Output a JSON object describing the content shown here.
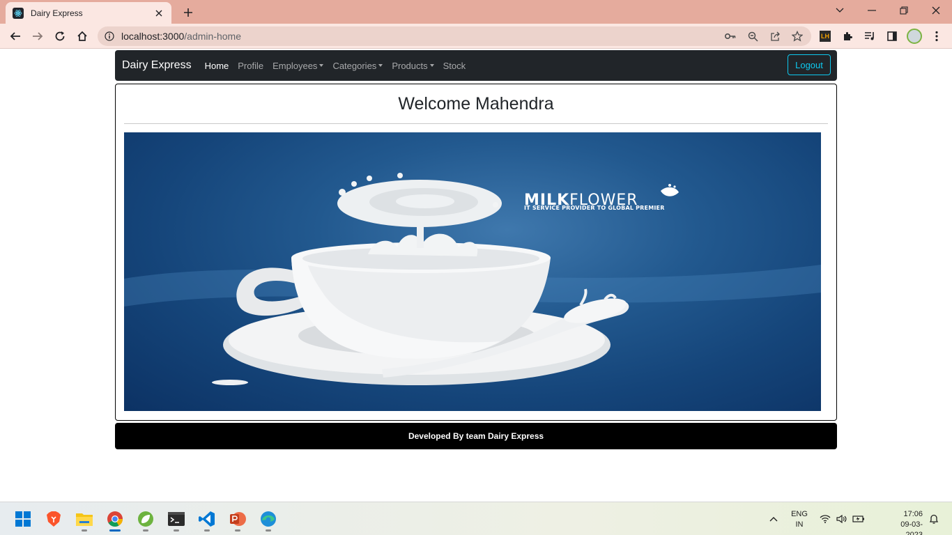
{
  "browser": {
    "tab_title": "Dairy Express",
    "url_host": "localhost:3000",
    "url_path": "/admin-home"
  },
  "navbar": {
    "brand": "Dairy Express",
    "items": [
      {
        "label": "Home",
        "active": true,
        "dropdown": false
      },
      {
        "label": "Profile",
        "active": false,
        "dropdown": false
      },
      {
        "label": "Employees",
        "active": false,
        "dropdown": true
      },
      {
        "label": "Categories",
        "active": false,
        "dropdown": true
      },
      {
        "label": "Products",
        "active": false,
        "dropdown": true
      },
      {
        "label": "Stock",
        "active": false,
        "dropdown": false
      }
    ],
    "logout_label": "Logout"
  },
  "main": {
    "welcome": "Welcome Mahendra",
    "banner": {
      "brand_bold": "MILK",
      "brand_rest": "FLOWER",
      "tagline": "IT SERVICE PROVIDER TO GLOBAL PREMIER"
    }
  },
  "footer": {
    "text": "Developed By team Dairy Express"
  },
  "taskbar": {
    "language_line1": "ENG",
    "language_line2": "IN",
    "time": "17:06",
    "date": "09-03-2023"
  },
  "colors": {
    "navbar_bg": "#212529",
    "logout_accent": "#0dcaf0",
    "footer_bg": "#000000",
    "chrome_tabbar": "#e5ab9d"
  }
}
